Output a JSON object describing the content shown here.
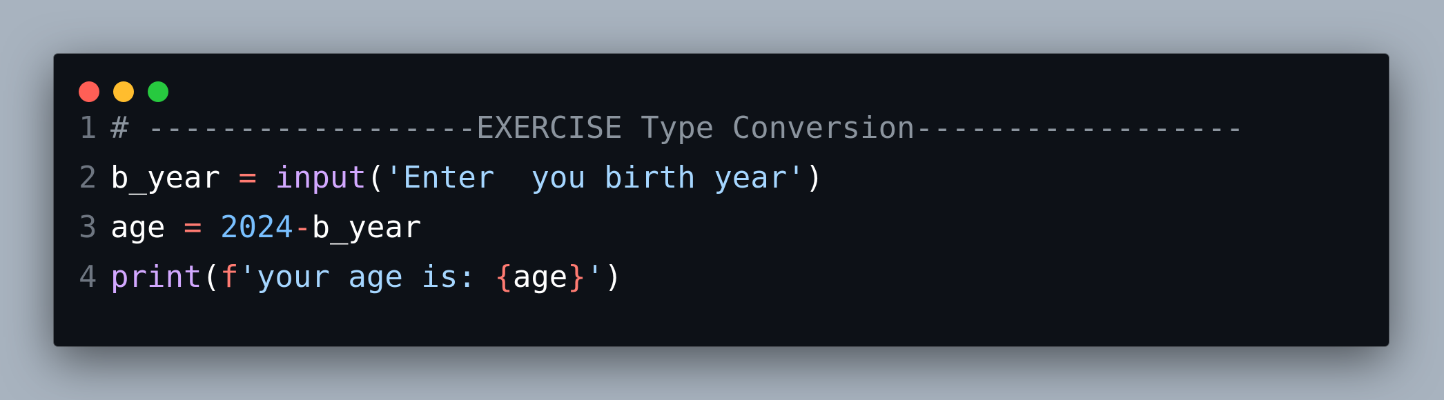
{
  "window": {
    "controls": {
      "close_color": "#ff5f56",
      "minimize_color": "#ffbd2e",
      "maximize_color": "#27c93f"
    }
  },
  "code": {
    "lines": [
      {
        "number": "1",
        "tokens": [
          {
            "text": "# ------------------EXERCISE Type Conversion------------------",
            "kind": "comment"
          }
        ]
      },
      {
        "number": "2",
        "tokens": [
          {
            "text": "b_year",
            "kind": "var"
          },
          {
            "text": " ",
            "kind": "punc"
          },
          {
            "text": "=",
            "kind": "op"
          },
          {
            "text": " ",
            "kind": "punc"
          },
          {
            "text": "input",
            "kind": "fn"
          },
          {
            "text": "(",
            "kind": "punc"
          },
          {
            "text": "'Enter  you birth year'",
            "kind": "str"
          },
          {
            "text": ")",
            "kind": "punc"
          }
        ]
      },
      {
        "number": "3",
        "tokens": [
          {
            "text": "age",
            "kind": "var"
          },
          {
            "text": " ",
            "kind": "punc"
          },
          {
            "text": "=",
            "kind": "op"
          },
          {
            "text": " ",
            "kind": "punc"
          },
          {
            "text": "2024",
            "kind": "num"
          },
          {
            "text": "-",
            "kind": "op"
          },
          {
            "text": "b_year",
            "kind": "var"
          }
        ]
      },
      {
        "number": "4",
        "tokens": [
          {
            "text": "print",
            "kind": "fn"
          },
          {
            "text": "(",
            "kind": "punc"
          },
          {
            "text": "f",
            "kind": "fpre"
          },
          {
            "text": "'your age is: ",
            "kind": "str"
          },
          {
            "text": "{",
            "kind": "brace"
          },
          {
            "text": "age",
            "kind": "var"
          },
          {
            "text": "}",
            "kind": "brace"
          },
          {
            "text": "'",
            "kind": "str"
          },
          {
            "text": ")",
            "kind": "punc"
          }
        ]
      }
    ]
  }
}
